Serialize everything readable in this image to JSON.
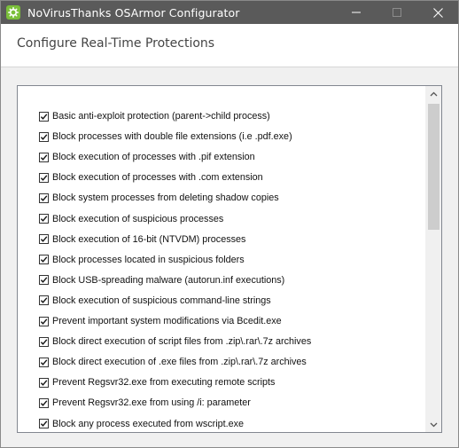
{
  "window": {
    "title": "NoVirusThanks OSArmor Configurator",
    "icon": "gear-icon",
    "titlebar_color": "#5a5a5a",
    "app_icon_color": "#7bbf3a"
  },
  "header": {
    "title": "Configure Real-Time Protections"
  },
  "options": [
    {
      "label": "Basic anti-exploit protection (parent->child process)",
      "checked": true
    },
    {
      "label": "Block processes with double file extensions (i.e .pdf.exe)",
      "checked": true
    },
    {
      "label": "Block execution of processes with .pif extension",
      "checked": true
    },
    {
      "label": "Block execution of processes with .com extension",
      "checked": true
    },
    {
      "label": "Block system processes from deleting shadow copies",
      "checked": true
    },
    {
      "label": "Block execution of suspicious processes",
      "checked": true
    },
    {
      "label": "Block execution of 16-bit (NTVDM) processes",
      "checked": true
    },
    {
      "label": "Block processes located in suspicious folders",
      "checked": true
    },
    {
      "label": "Block USB-spreading malware (autorun.inf executions)",
      "checked": true
    },
    {
      "label": "Block execution of suspicious command-line strings",
      "checked": true
    },
    {
      "label": "Prevent important system modifications via Bcedit.exe",
      "checked": true
    },
    {
      "label": "Block direct execution of script files from .zip\\.rar\\.7z archives",
      "checked": true
    },
    {
      "label": "Block direct execution of .exe files from .zip\\.rar\\.7z archives",
      "checked": true
    },
    {
      "label": "Prevent Regsvr32.exe from executing remote scripts",
      "checked": true
    },
    {
      "label": "Prevent Regsvr32.exe from using /i: parameter",
      "checked": true
    },
    {
      "label": "Block any process executed from wscript.exe",
      "checked": true
    }
  ]
}
